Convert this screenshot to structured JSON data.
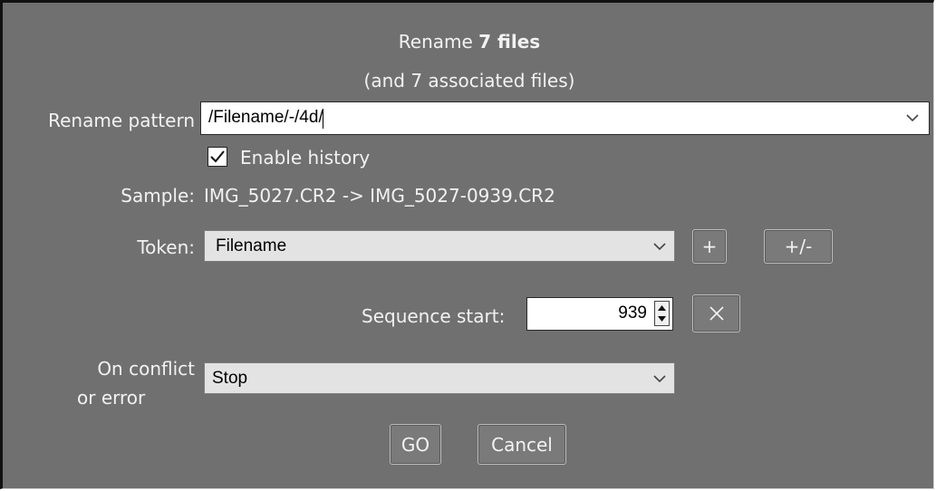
{
  "dialog": {
    "title_prefix": "Rename",
    "title_bold": "7 files",
    "subtitle": "(and 7 associated files)"
  },
  "pattern": {
    "label": "Rename pattern",
    "value": "/Filename/-/4d/"
  },
  "history": {
    "label": "Enable history",
    "checked": true
  },
  "sample": {
    "label": "Sample:",
    "value": "IMG_5027.CR2 -> IMG_5027-0939.CR2"
  },
  "token": {
    "label": "Token:",
    "selected": "Filename",
    "add_label": "+",
    "toggle_label": "+/-"
  },
  "sequence": {
    "label": "Sequence start:",
    "value": "939",
    "clear_icon": "x-icon"
  },
  "conflict": {
    "label_line1": "On conflict",
    "label_line2": "or error",
    "selected": "Stop"
  },
  "actions": {
    "go_label": "GO",
    "cancel_label": "Cancel"
  }
}
